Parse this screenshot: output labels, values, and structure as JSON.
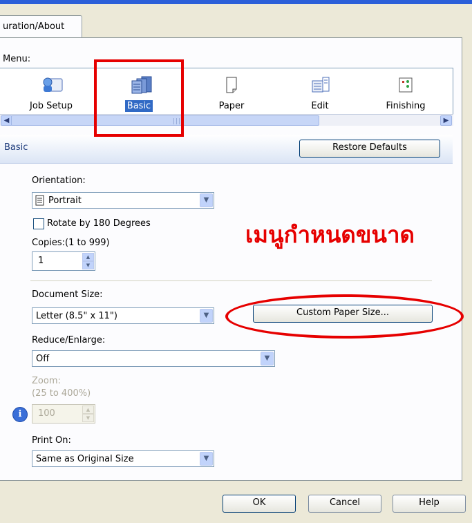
{
  "tab": {
    "label": "uration/About"
  },
  "menu": {
    "label": "Menu:",
    "items": [
      {
        "label": "Job Setup",
        "icon": "job-setup-icon"
      },
      {
        "label": "Basic",
        "icon": "basic-icon",
        "selected": true
      },
      {
        "label": "Paper",
        "icon": "paper-icon"
      },
      {
        "label": "Edit",
        "icon": "edit-icon"
      },
      {
        "label": "Finishing",
        "icon": "finishing-icon"
      }
    ]
  },
  "section": {
    "title": "Basic",
    "restore_label": "Restore Defaults"
  },
  "orientation": {
    "label": "Orientation:",
    "value": "Portrait"
  },
  "rotate": {
    "label": "Rotate by 180 Degrees",
    "checked": false
  },
  "copies": {
    "label": "Copies:(1 to 999)",
    "value": "1"
  },
  "document_size": {
    "label": "Document Size:",
    "value": "Letter (8.5\" x 11\")"
  },
  "custom_paper": {
    "label": "Custom Paper Size..."
  },
  "reduce": {
    "label": "Reduce/Enlarge:",
    "value": "Off"
  },
  "zoom": {
    "label": "Zoom:",
    "range": "(25 to 400%)",
    "value": "100"
  },
  "print_on": {
    "label": "Print On:",
    "value": "Same as Original Size"
  },
  "buttons": {
    "ok": "OK",
    "cancel": "Cancel",
    "help": "Help"
  },
  "annotation": {
    "text": "เมนูกำหนดขนาด"
  },
  "colors": {
    "accent": "#316ac5",
    "annotation": "#e60000"
  }
}
